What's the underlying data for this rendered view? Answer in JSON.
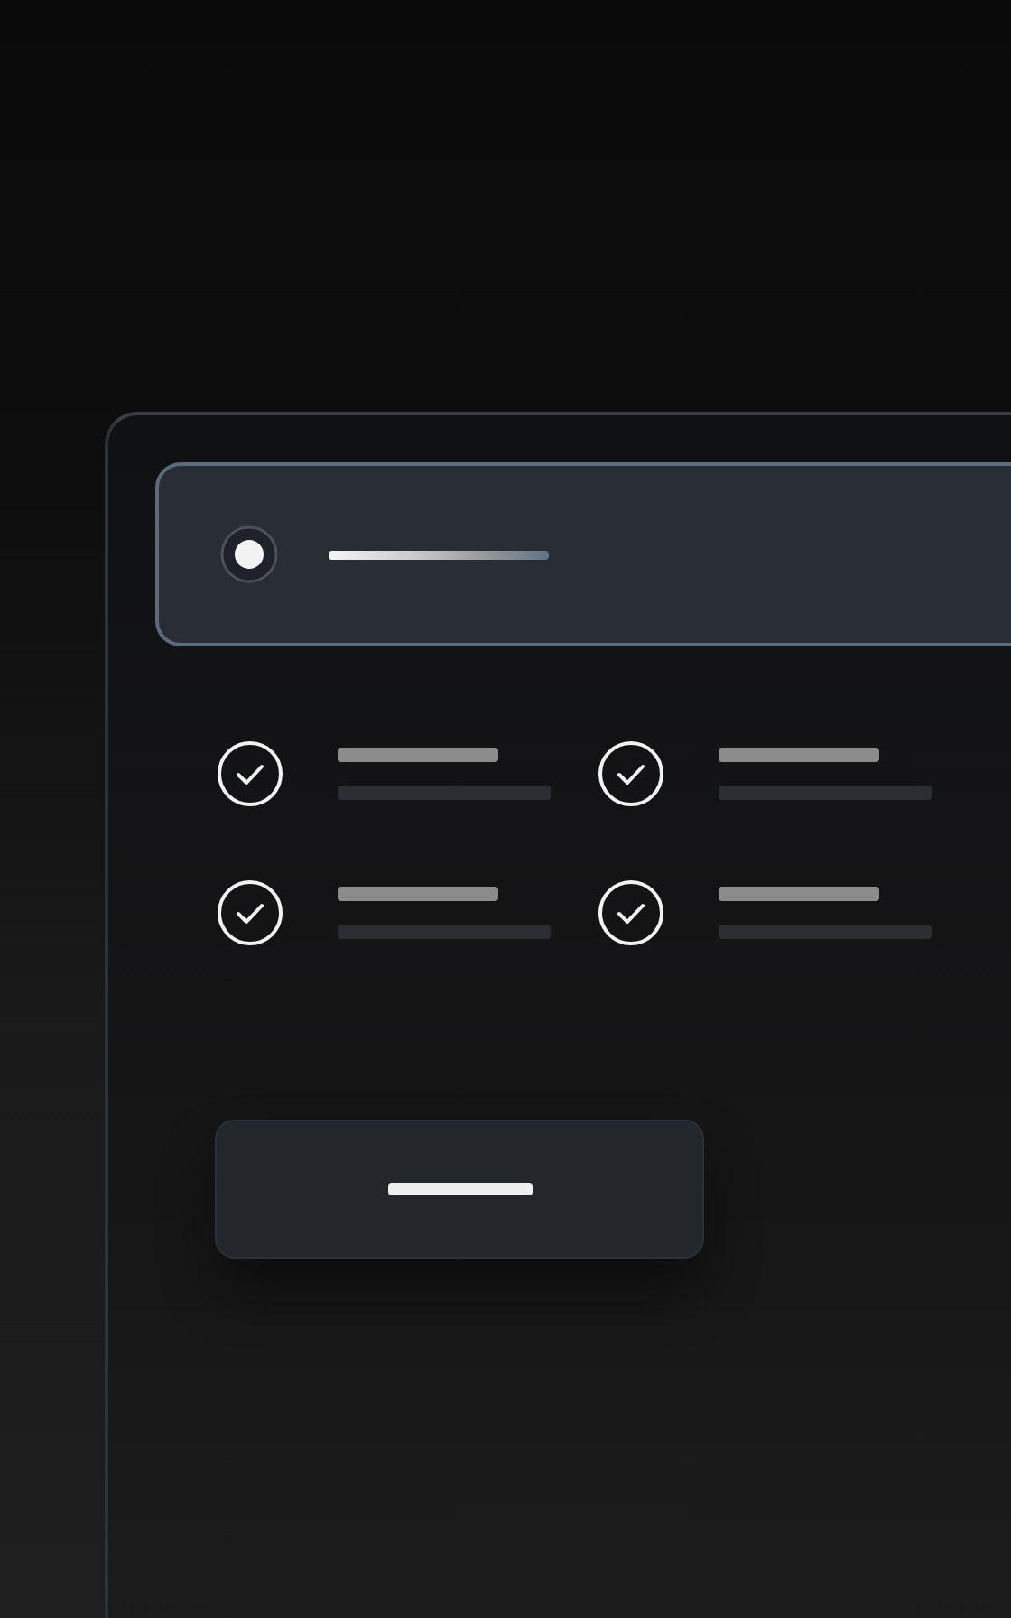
{
  "option": {
    "selected": true
  },
  "features": [
    {
      "checked": true
    },
    {
      "checked": true
    },
    {
      "checked": true
    },
    {
      "checked": true
    }
  ],
  "button": {
    "kind": "primary"
  }
}
